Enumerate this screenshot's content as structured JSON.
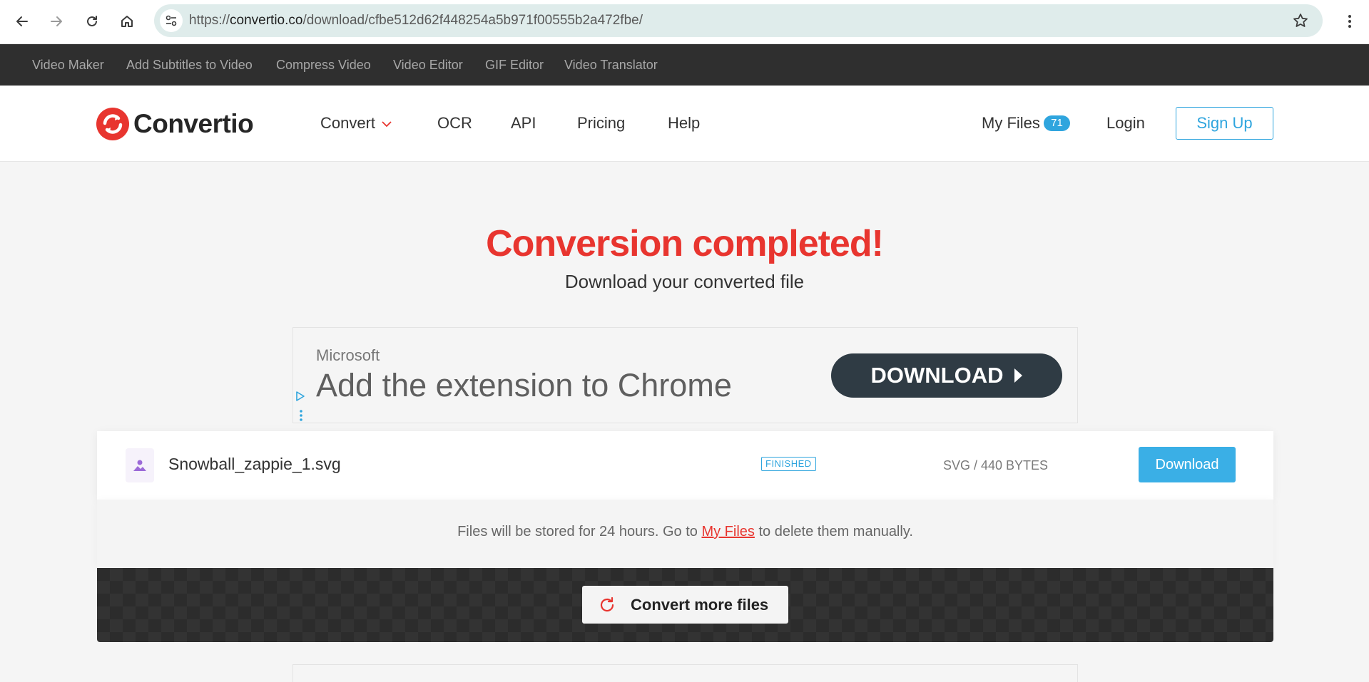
{
  "browser": {
    "url": "https://convertio.co/download/cfbe512d62f448254a5b971f00555b2a472fbe/",
    "url_host_prefix": "https://",
    "url_host": "convertio.co",
    "url_path": "/download/cfbe512d62f448254a5b971f00555b2a472fbe/"
  },
  "tools_strip": {
    "items": [
      "Video Maker",
      "Add Subtitles to Video",
      "Compress Video",
      "Video Editor",
      "GIF Editor",
      "Video Translator"
    ]
  },
  "header": {
    "logo_text": "Convertio",
    "nav": [
      "Convert",
      "OCR",
      "API",
      "Pricing",
      "Help"
    ],
    "my_files_label": "My Files",
    "my_files_count": "71",
    "login_label": "Login",
    "signup_label": "Sign Up",
    "brand_color": "#e8352f",
    "accent_color": "#2fa5de"
  },
  "main": {
    "title": "Conversion completed!",
    "subtitle": "Download your converted file"
  },
  "ad": {
    "brand": "Microsoft",
    "headline": "Add the extension to Chrome",
    "button_label": "DOWNLOAD"
  },
  "file": {
    "name": "Snowball_zappie_1.svg",
    "status": "FINISHED",
    "size": "SVG / 440 BYTES",
    "download_label": "Download"
  },
  "note": {
    "before": "Files will be stored for 24 hours. Go to ",
    "link": "My Files",
    "after": " to delete them manually."
  },
  "actions": {
    "convert_more_label": "Convert more files"
  }
}
